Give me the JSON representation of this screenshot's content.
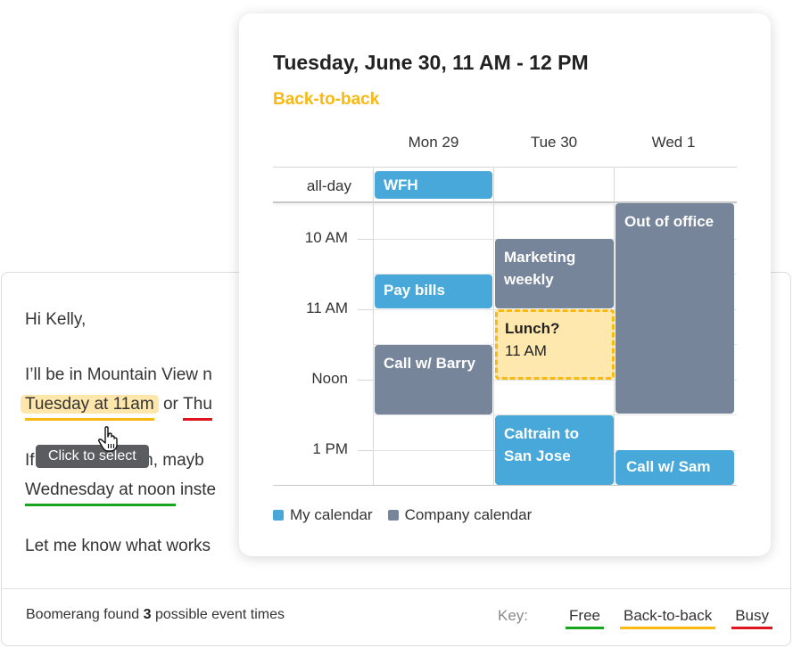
{
  "email": {
    "greeting": "Hi Kelly,",
    "line1": "I’ll be in Mountain View n",
    "line2_option1": "Tuesday at 11am",
    "line2_or": " or ",
    "line2_option2": "Thu",
    "line3_start": "If",
    "line3_end": "en, mayb",
    "line4_option": "Wednesday at noon",
    "line4_end": " inste",
    "line5": "Let me know what works",
    "tooltip": "Click to select"
  },
  "footer": {
    "prefix": "Boomerang found ",
    "count": "3",
    "suffix": " possible event times",
    "key_label": "Key:",
    "key_items": [
      {
        "label": "Free",
        "color": "#16a51c"
      },
      {
        "label": "Back-to-back",
        "color": "#f9b812"
      },
      {
        "label": "Busy",
        "color": "#e0141f"
      }
    ]
  },
  "popup": {
    "title": "Tuesday, June 30, 11 AM - 12 PM",
    "status": "Back-to-back",
    "status_color": "#f9b812",
    "days": [
      "Mon 29",
      "Tue 30",
      "Wed 1"
    ],
    "allday_label": "all-day",
    "times": [
      "10 AM",
      "11 AM",
      "Noon",
      "1 PM"
    ],
    "allday_events": [
      {
        "title": "WFH",
        "day": 0,
        "calendar": "my"
      }
    ],
    "events": [
      {
        "title": "Out of office",
        "day": 2,
        "calendar": "company"
      },
      {
        "title": "Marketing weekly",
        "day": 1,
        "calendar": "company"
      },
      {
        "title": "Pay bills",
        "day": 0,
        "calendar": "my"
      },
      {
        "title": "Call w/ Barry",
        "day": 0,
        "calendar": "company"
      },
      {
        "title": "Caltrain to San Jose",
        "day": 1,
        "calendar": "my"
      },
      {
        "title": "Call w/ Sam",
        "day": 2,
        "calendar": "my"
      }
    ],
    "proposed": {
      "title": "Lunch?",
      "time": "11 AM",
      "day": 1
    },
    "legend": [
      {
        "label": "My calendar",
        "color": "#48a8d9"
      },
      {
        "label": "Company calendar",
        "color": "#76859a"
      }
    ]
  }
}
